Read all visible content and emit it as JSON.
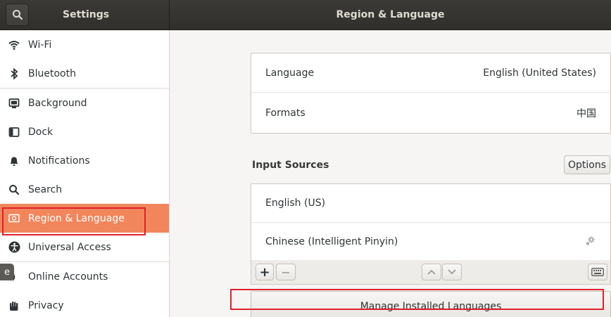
{
  "header": {
    "left_title": "Settings",
    "right_title": "Region & Language"
  },
  "sidebar": {
    "items": [
      {
        "label": "Wi-Fi",
        "icon": "wifi-icon"
      },
      {
        "label": "Bluetooth",
        "icon": "bluetooth-icon"
      },
      {
        "label": "Background",
        "icon": "background-icon"
      },
      {
        "label": "Dock",
        "icon": "dock-icon"
      },
      {
        "label": "Notifications",
        "icon": "bell-icon"
      },
      {
        "label": "Search",
        "icon": "search-icon"
      },
      {
        "label": "Region & Language",
        "icon": "region-flag-icon",
        "active": true
      },
      {
        "label": "Universal Access",
        "icon": "accessibility-icon"
      },
      {
        "label": "Online Accounts",
        "icon": "online-accounts-icon"
      },
      {
        "label": "Privacy",
        "icon": "hand-icon"
      }
    ]
  },
  "language_panel": {
    "language_label": "Language",
    "language_value": "English (United States)",
    "formats_label": "Formats",
    "formats_value": "中国"
  },
  "input_sources": {
    "title": "Input Sources",
    "options_label": "Options",
    "sources": [
      {
        "label": "English (US)"
      },
      {
        "label": "Chinese (Intelligent Pinyin)",
        "has_settings": true
      }
    ],
    "toolbar": {
      "add_label": "+",
      "remove_label": "−"
    }
  },
  "manage_button_label": "Manage Installed Languages",
  "floating_tab_label": "e",
  "colors": {
    "accent": "#f1865c",
    "headerbar": "#33322e",
    "annotation": "#e0202a"
  }
}
